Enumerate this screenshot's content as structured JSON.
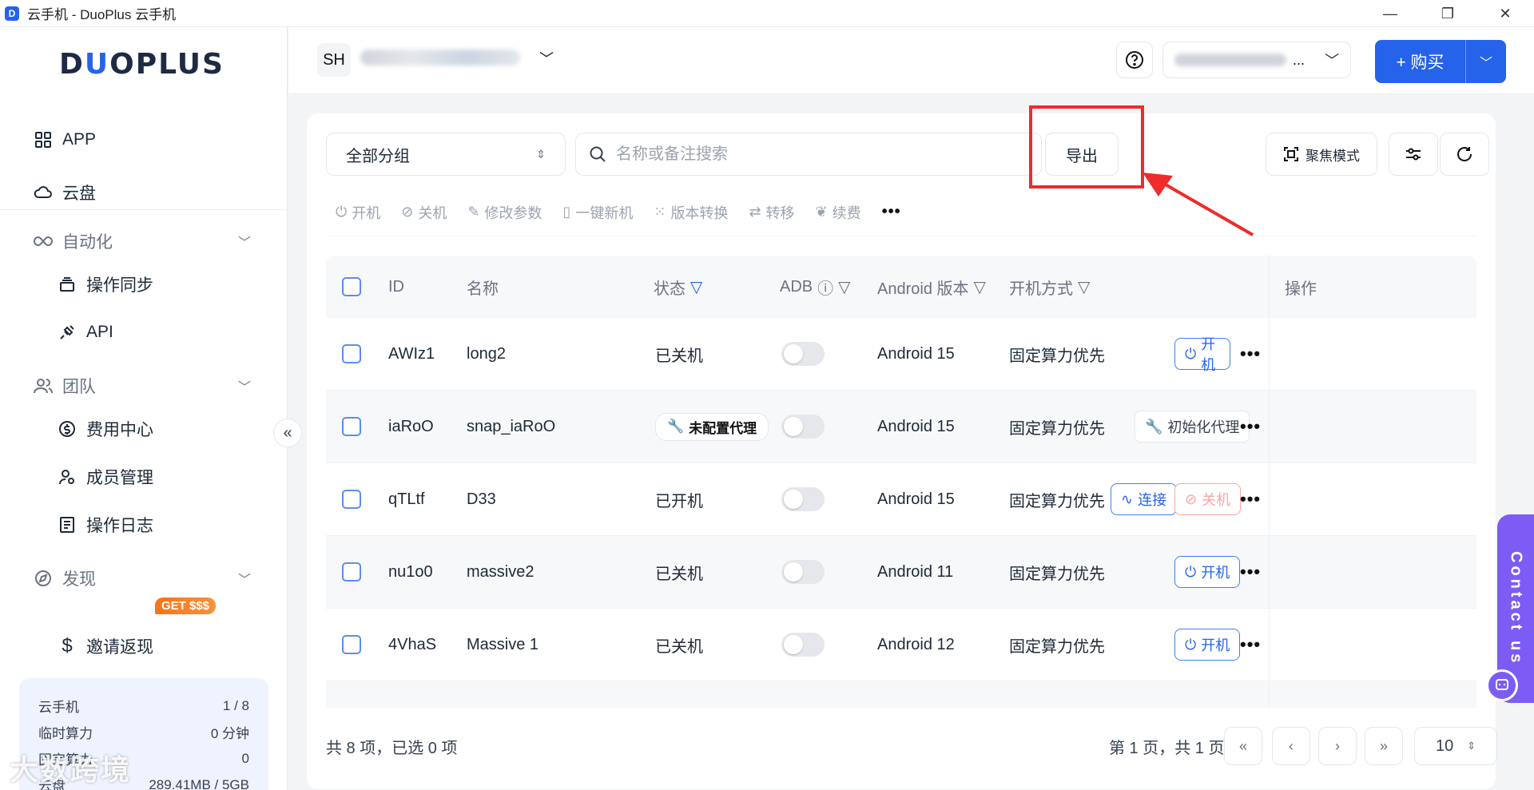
{
  "window": {
    "title": "云手机 - DuoPlus 云手机",
    "minimize": "—",
    "restore": "❐",
    "close": "✕"
  },
  "sidebar": {
    "logo_prefix": "D",
    "logo_u": "U",
    "logo_suffix": "OPLUS",
    "top_items": [
      {
        "label": "APP"
      },
      {
        "label": "云盘"
      }
    ],
    "automation": {
      "label": "自动化",
      "items": [
        {
          "label": "操作同步"
        },
        {
          "label": "API"
        }
      ]
    },
    "team": {
      "label": "团队",
      "items": [
        {
          "label": "费用中心"
        },
        {
          "label": "成员管理"
        },
        {
          "label": "操作日志"
        }
      ]
    },
    "discover": {
      "label": "发现",
      "items": [
        {
          "label": "邀请返现",
          "badge": "GET $$$"
        }
      ]
    },
    "quota": [
      {
        "label": "云手机",
        "value": "1 / 8"
      },
      {
        "label": "临时算力",
        "value": "0 分钟"
      },
      {
        "label": "固定算力",
        "value": "0"
      },
      {
        "label": "云盘",
        "value": "289.41MB / 5GB"
      }
    ],
    "collapse": "«",
    "watermark": "大数跨境"
  },
  "header": {
    "avatar": "SH",
    "buy_label": "+ 购买",
    "user_dots": "..."
  },
  "toolbar": {
    "group_select": "全部分组",
    "search_placeholder": "名称或备注搜索",
    "export": "导出",
    "focus_mode": "聚焦模式"
  },
  "actions": [
    {
      "label": "开机",
      "icon": "power-icon"
    },
    {
      "label": "关机",
      "icon": "power-off-icon"
    },
    {
      "label": "修改参数",
      "icon": "edit-params-icon"
    },
    {
      "label": "一键新机",
      "icon": "new-device-icon"
    },
    {
      "label": "版本转换",
      "icon": "version-switch-icon"
    },
    {
      "label": "转移",
      "icon": "transfer-icon"
    },
    {
      "label": "续费",
      "icon": "renew-icon"
    }
  ],
  "table": {
    "columns": {
      "id": "ID",
      "name": "名称",
      "status": "状态",
      "adb": "ADB",
      "android": "Android 版本",
      "boot": "开机方式",
      "ops": "操作"
    },
    "rows": [
      {
        "id": "AWIz1",
        "name": "long2",
        "status": "已关机",
        "status_type": "text",
        "android": "Android 15",
        "boot": "固定算力优先",
        "ops": [
          "开机"
        ]
      },
      {
        "id": "iaRoO",
        "name": "snap_iaRoO",
        "status": "未配置代理",
        "status_type": "tag",
        "android": "Android 15",
        "boot": "固定算力优先",
        "ops": [
          "初始化代理"
        ]
      },
      {
        "id": "qTLtf",
        "name": "D33",
        "status": "已开机",
        "status_type": "text",
        "android": "Android 15",
        "boot": "固定算力优先",
        "ops": [
          "连接",
          "关机"
        ]
      },
      {
        "id": "nu1o0",
        "name": "massive2",
        "status": "已关机",
        "status_type": "text",
        "android": "Android 11",
        "boot": "固定算力优先",
        "ops": [
          "开机"
        ]
      },
      {
        "id": "4VhaS",
        "name": "Massive 1",
        "status": "已关机",
        "status_type": "text",
        "android": "Android 12",
        "boot": "固定算力优先",
        "ops": [
          "开机"
        ]
      }
    ]
  },
  "footer": {
    "summary": "共 8 项，已选 0 项",
    "page_info": "第 1 页，共 1 页",
    "page_size": "10"
  },
  "contact": "Contact us",
  "colors": {
    "primary": "#2563eb",
    "annotation_red": "#ef2b2b",
    "contact_purple": "#7c5cf5"
  }
}
